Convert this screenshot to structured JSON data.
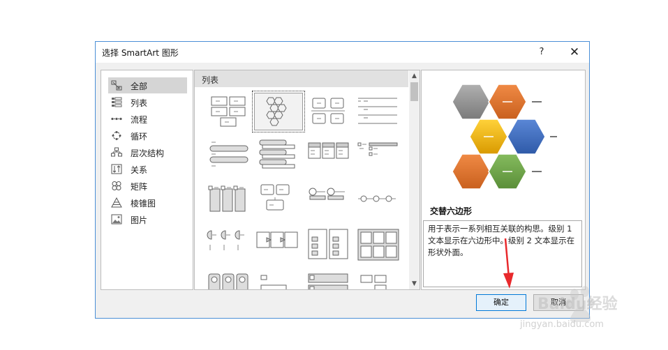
{
  "dialog": {
    "title": "选择 SmartArt 图形",
    "help_label": "?",
    "close_label": "✕"
  },
  "categories": [
    {
      "label": "全部",
      "icon": "all-icon",
      "selected": true
    },
    {
      "label": "列表",
      "icon": "list-icon"
    },
    {
      "label": "流程",
      "icon": "process-icon"
    },
    {
      "label": "循环",
      "icon": "cycle-icon"
    },
    {
      "label": "层次结构",
      "icon": "hierarchy-icon"
    },
    {
      "label": "关系",
      "icon": "relationship-icon"
    },
    {
      "label": "矩阵",
      "icon": "matrix-icon"
    },
    {
      "label": "棱锥图",
      "icon": "pyramid-icon"
    },
    {
      "label": "图片",
      "icon": "picture-icon"
    }
  ],
  "layouts": {
    "header": "列表",
    "selected_index": 1
  },
  "preview": {
    "title": "交替六边形",
    "description": "用于表示一系列相互关联的构思。级别 1 文本显示在六边形中。级别 2 文本显示在形状外面。"
  },
  "buttons": {
    "ok": "确定",
    "cancel": "取消"
  },
  "watermark": {
    "brand": "Baidu经验",
    "url": "jingyan.baidu.com"
  },
  "colors": {
    "accent": "#0078d7",
    "hex_gray": "#8a8a8a",
    "hex_orange": "#e2742e",
    "hex_yellow": "#f2b500",
    "hex_blue": "#3e6bbf",
    "hex_green": "#6ea34a",
    "annotation_arrow": "#e8292c"
  }
}
